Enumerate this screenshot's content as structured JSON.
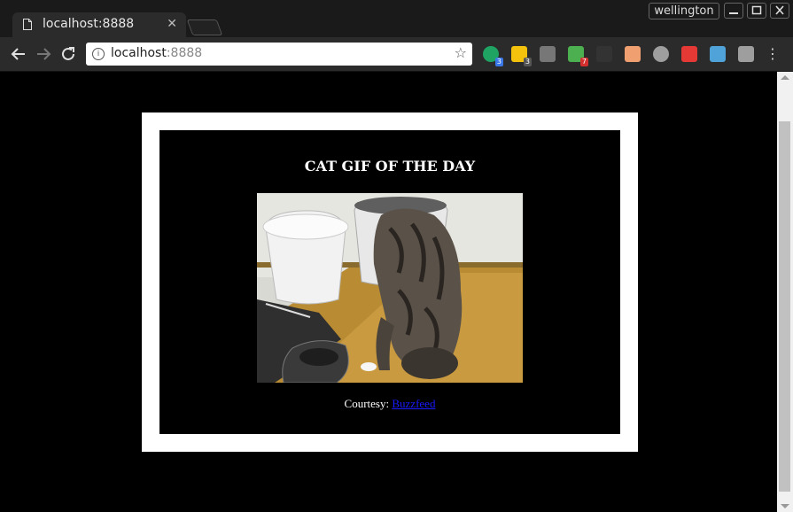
{
  "window": {
    "user": "wellington",
    "controls": [
      "minimize",
      "maximize",
      "close"
    ]
  },
  "tab": {
    "title": "localhost:8888"
  },
  "address_bar": {
    "host": "localhost",
    "port": ":8888"
  },
  "extensions": [
    {
      "icon": "green-circle-icon",
      "color": "#1fa463",
      "badge": "3",
      "badge_color": "#3b78e7"
    },
    {
      "icon": "yellow-note-icon",
      "color": "#f4c20d",
      "badge": "3",
      "badge_color": "#555555"
    },
    {
      "icon": "pocket-icon",
      "color": "#777777",
      "badge": "",
      "badge_color": ""
    },
    {
      "icon": "download-arrow-icon",
      "color": "#4caf50",
      "badge": "7",
      "badge_color": "#d32f2f"
    },
    {
      "icon": "dark-leaf-icon",
      "color": "#333333",
      "badge": "",
      "badge_color": ""
    },
    {
      "icon": "face-icon",
      "color": "#f0a070",
      "badge": "",
      "badge_color": ""
    },
    {
      "icon": "m-circle-icon",
      "color": "#9e9e9e",
      "badge": "",
      "badge_color": ""
    },
    {
      "icon": "red-cross-icon",
      "color": "#e53935",
      "badge": "",
      "badge_color": ""
    },
    {
      "icon": "skype-s-icon",
      "color": "#4fa3d9",
      "badge": "",
      "badge_color": ""
    },
    {
      "icon": "gray-square-icon",
      "color": "#9e9e9e",
      "badge": "",
      "badge_color": ""
    }
  ],
  "page": {
    "heading": "CAT GIF OF THE DAY",
    "courtesy_label": "Courtesy: ",
    "courtesy_link": "Buzzfeed"
  },
  "colors": {
    "background": "#000000",
    "frame": "#ffffff",
    "link": "#1a1aff"
  }
}
